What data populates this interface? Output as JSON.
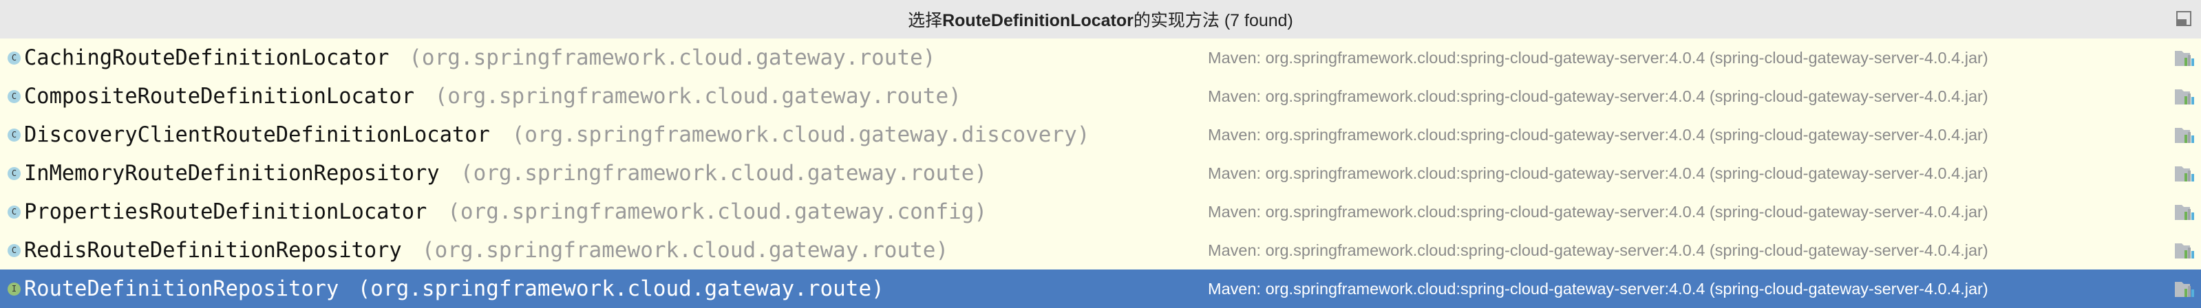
{
  "header": {
    "title_prefix": "选择",
    "title_bold": "RouteDefinitionLocator",
    "title_suffix": "的实现方法 (7 found)"
  },
  "items": [
    {
      "kind": "c",
      "name": "CachingRouteDefinitionLocator",
      "pkg": "(org.springframework.cloud.gateway.route)",
      "location": "Maven: org.springframework.cloud:spring-cloud-gateway-server:4.0.4 (spring-cloud-gateway-server-4.0.4.jar)"
    },
    {
      "kind": "c",
      "name": "CompositeRouteDefinitionLocator",
      "pkg": "(org.springframework.cloud.gateway.route)",
      "location": "Maven: org.springframework.cloud:spring-cloud-gateway-server:4.0.4 (spring-cloud-gateway-server-4.0.4.jar)"
    },
    {
      "kind": "c",
      "name": "DiscoveryClientRouteDefinitionLocator",
      "pkg": "(org.springframework.cloud.gateway.discovery)",
      "location": "Maven: org.springframework.cloud:spring-cloud-gateway-server:4.0.4 (spring-cloud-gateway-server-4.0.4.jar)"
    },
    {
      "kind": "c",
      "name": "InMemoryRouteDefinitionRepository",
      "pkg": "(org.springframework.cloud.gateway.route)",
      "location": "Maven: org.springframework.cloud:spring-cloud-gateway-server:4.0.4 (spring-cloud-gateway-server-4.0.4.jar)"
    },
    {
      "kind": "c",
      "name": "PropertiesRouteDefinitionLocator",
      "pkg": "(org.springframework.cloud.gateway.config)",
      "location": "Maven: org.springframework.cloud:spring-cloud-gateway-server:4.0.4 (spring-cloud-gateway-server-4.0.4.jar)"
    },
    {
      "kind": "c",
      "name": "RedisRouteDefinitionRepository",
      "pkg": "(org.springframework.cloud.gateway.route)",
      "location": "Maven: org.springframework.cloud:spring-cloud-gateway-server:4.0.4 (spring-cloud-gateway-server-4.0.4.jar)"
    },
    {
      "kind": "i",
      "name": "RouteDefinitionRepository",
      "pkg": "(org.springframework.cloud.gateway.route)",
      "location": "Maven: org.springframework.cloud:spring-cloud-gateway-server:4.0.4 (spring-cloud-gateway-server-4.0.4.jar)",
      "selected": true
    }
  ],
  "icons": {
    "c": "C",
    "i": "I"
  },
  "colors": {
    "selection": "#4a7cc0",
    "background": "#fefee9"
  }
}
